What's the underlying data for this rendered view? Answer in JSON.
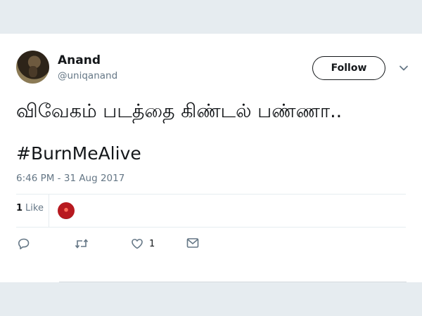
{
  "tweet": {
    "name": "Anand",
    "handle": "@uniqanand",
    "follow_label": "Follow",
    "text": "விவேகம் படத்தை கிண்டல் பண்ணா..",
    "hashtag": "#BurnMeAlive",
    "timestamp": "6:46 PM - 31 Aug 2017",
    "like_count": "1",
    "like_label": "Like",
    "like_action_count": "1"
  },
  "icons": [
    "reply-icon",
    "retweet-icon",
    "heart-icon",
    "direct-message-icon",
    "chevron-down-icon"
  ],
  "colors": {
    "background": "#e6ecf0",
    "secondary_text": "#657786",
    "primary_text": "#14171a"
  }
}
